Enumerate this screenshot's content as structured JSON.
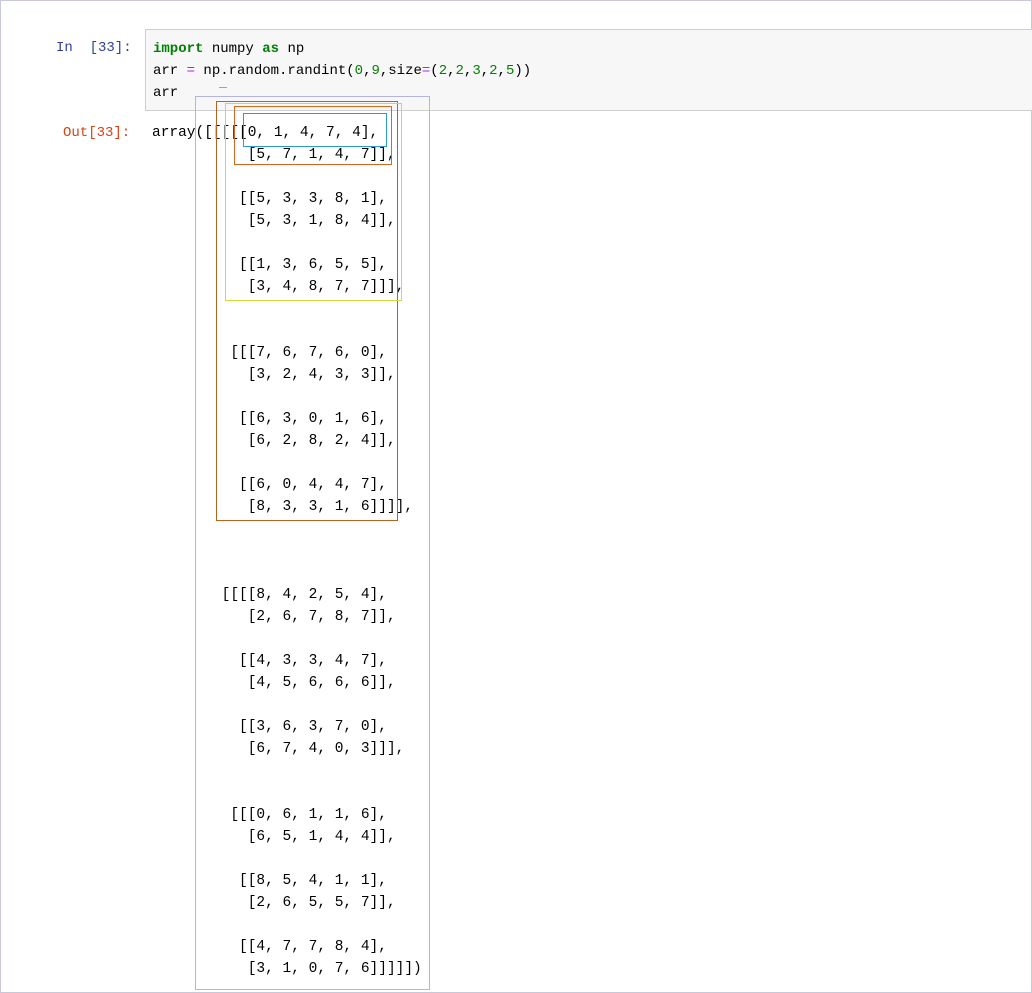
{
  "notebook": {
    "input_prompt": "In  [33]:",
    "output_prompt": "Out[33]:",
    "code": {
      "line1": {
        "kw_import": "import",
        "module": " numpy ",
        "kw_as": "as",
        "alias": " np"
      },
      "line2": {
        "lhs": "arr ",
        "eq": "=",
        "call": " np.random.randint(",
        "a0": "0",
        "c1": ",",
        "a1": "9",
        "c2": ",size",
        "eq2": "=",
        "paren": "(",
        "s0": "2",
        "c3": ",",
        "s1": "2",
        "c4": ",",
        "s2": "3",
        "c5": ",",
        "s3": "2",
        "c6": ",",
        "s4": "5",
        "close": "))"
      },
      "line3": "arr"
    },
    "output_text": "array([[[[[0, 1, 4, 7, 4],\n           [5, 7, 1, 4, 7]],\n\n          [[5, 3, 3, 8, 1],\n           [5, 3, 1, 8, 4]],\n\n          [[1, 3, 6, 5, 5],\n           [3, 4, 8, 7, 7]]],\n\n\n         [[[7, 6, 7, 6, 0],\n           [3, 2, 4, 3, 3]],\n\n          [[6, 3, 0, 1, 6],\n           [6, 2, 8, 2, 4]],\n\n          [[6, 0, 4, 4, 7],\n           [8, 3, 3, 1, 6]]]],\n\n\n\n        [[[[8, 4, 2, 5, 4],\n           [2, 6, 7, 8, 7]],\n\n          [[4, 3, 3, 4, 7],\n           [4, 5, 6, 6, 6]],\n\n          [[3, 6, 3, 7, 0],\n           [6, 7, 4, 0, 3]]],\n\n\n         [[[0, 6, 1, 1, 6],\n           [6, 5, 1, 4, 4]],\n\n          [[8, 5, 4, 1, 1],\n           [2, 6, 5, 5, 7]],\n\n          [[4, 7, 7, 8, 4],\n           [3, 1, 0, 7, 6]]]]])"
  },
  "colors": {
    "in_prompt": "#303f9f",
    "out_prompt": "#d84315",
    "keyword": "#008000",
    "operator": "#aa22ff",
    "number": "#008000",
    "annotation_outer": "#b4b4e0",
    "annotation_axis1": "#b5651d",
    "annotation_axis2": "#d6d636",
    "annotation_axis3": "#d2691e",
    "annotation_axis4": "#2a9ad4"
  }
}
